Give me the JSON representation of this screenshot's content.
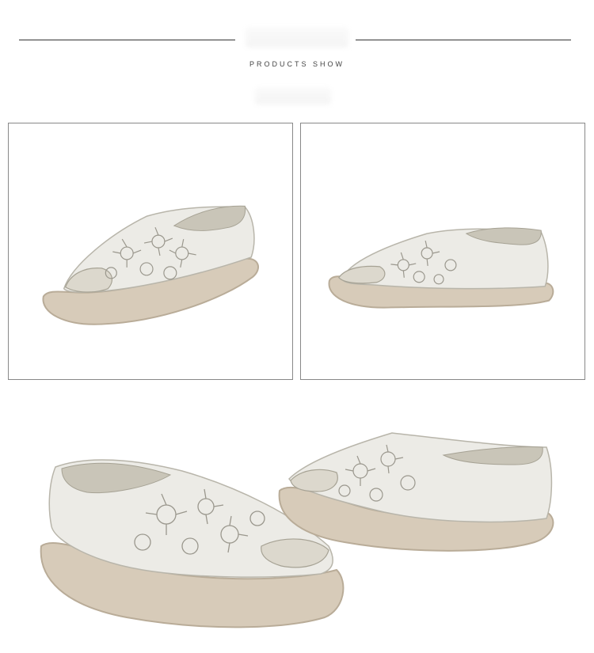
{
  "header": {
    "subtitle": "PRODUCTS SHOW"
  },
  "product": {
    "upper_color": "#ecebe6",
    "sole_color": "#d7cbb9",
    "lining_color": "#c9c5b8",
    "stitch_color": "#9a978d"
  },
  "images": [
    {
      "view": "left-facing-angle"
    },
    {
      "view": "left-facing-side"
    },
    {
      "view": "right-facing-angle"
    },
    {
      "view": "left-facing-angle-rear"
    }
  ]
}
